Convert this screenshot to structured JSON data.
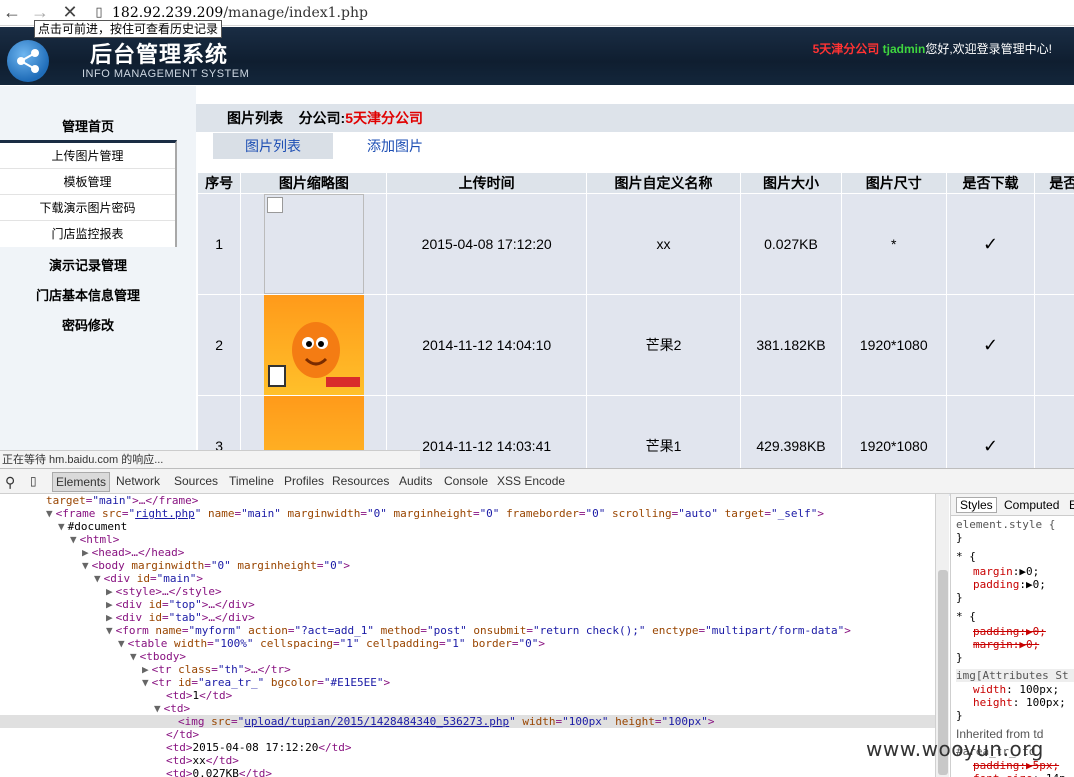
{
  "browser": {
    "url_domain": "182.92.239.209",
    "url_path": "/manage/index1.php",
    "tooltip": "点击可前进，按住可查看历史记录",
    "status": "正在等待 hm.baidu.com 的响应..."
  },
  "header": {
    "title": "后台管理系统",
    "subtitle": "INFO MANAGEMENT SYSTEM",
    "company": "5天津分公司",
    "user": "tjadmin",
    "welcome": "您好,欢迎登录管理中心!"
  },
  "sidebar": {
    "home": "管理首页",
    "sub": [
      "上传图片管理",
      "模板管理",
      "下载演示图片密码",
      "门店监控报表"
    ],
    "items": [
      "演示记录管理",
      "门店基本信息管理",
      "密码修改"
    ]
  },
  "main": {
    "heading": "图片列表",
    "company_label": "分公司:",
    "company": "5天津分公司",
    "tabs": [
      "图片列表",
      "添加图片"
    ],
    "columns": [
      "序号",
      "图片缩略图",
      "上传时间",
      "图片自定义名称",
      "图片大小",
      "图片尺寸",
      "是否下载",
      "是否"
    ],
    "rows": [
      {
        "no": "1",
        "time": "2015-04-08 17:12:20",
        "name": "xx",
        "size": "0.027KB",
        "dim": "*",
        "dl": "✓",
        "x": "✓"
      },
      {
        "no": "2",
        "time": "2014-11-12 14:04:10",
        "name": "芒果2",
        "size": "381.182KB",
        "dim": "1920*1080",
        "dl": "✓",
        "x": "✓"
      },
      {
        "no": "3",
        "time": "2014-11-12 14:03:41",
        "name": "芒果1",
        "size": "429.398KB",
        "dim": "1920*1080",
        "dl": "✓",
        "x": "✓"
      }
    ]
  },
  "devtools": {
    "tabs": [
      "Elements",
      "Network",
      "Sources",
      "Timeline",
      "Profiles",
      "Resources",
      "Audits",
      "Console",
      "XSS Encode"
    ],
    "style_tabs": [
      "Styles",
      "Computed",
      "E"
    ]
  },
  "watermark": "www.wooyun.org"
}
